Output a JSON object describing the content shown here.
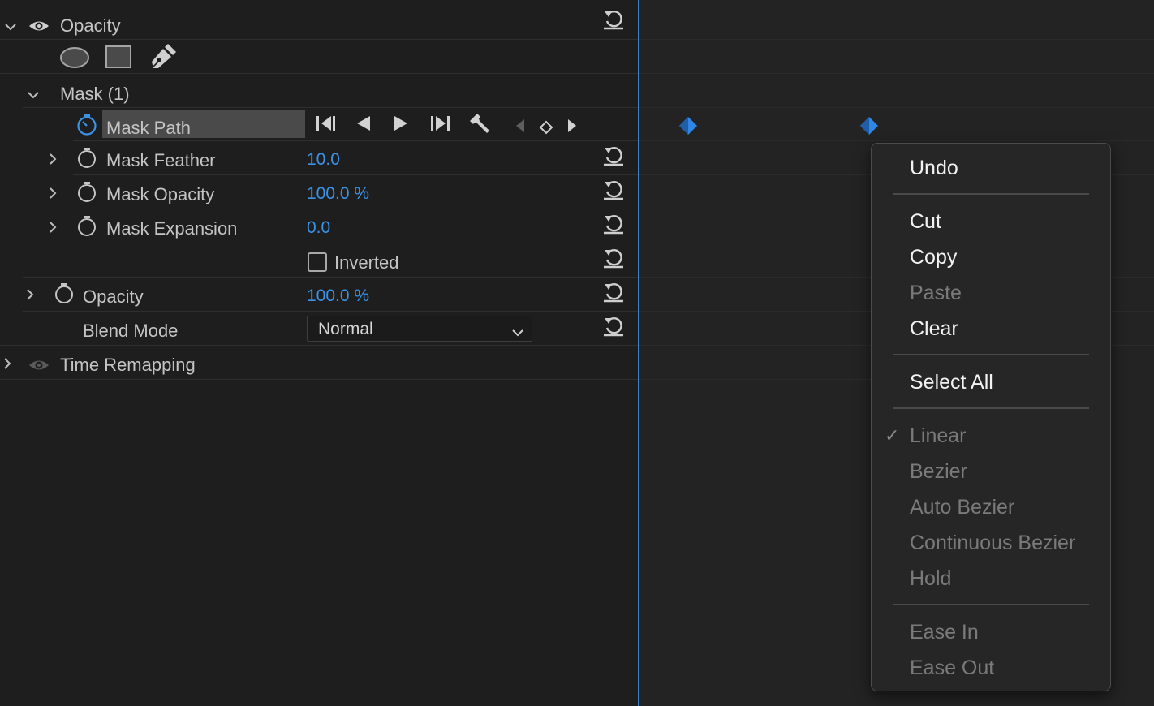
{
  "effects_panel": {
    "opacity_group": {
      "label": "Opacity"
    },
    "mask": {
      "label": "Mask (1)"
    },
    "mask_path": {
      "label": "Mask Path"
    },
    "mask_feather": {
      "label": "Mask Feather",
      "value": "10.0"
    },
    "mask_opacity": {
      "label": "Mask Opacity",
      "value": "100.0 %"
    },
    "mask_expansion": {
      "label": "Mask Expansion",
      "value": "0.0"
    },
    "inverted": {
      "label": "Inverted",
      "checked": false
    },
    "opacity": {
      "label": "Opacity",
      "value": "100.0 %"
    },
    "blend_mode": {
      "label": "Blend Mode",
      "selected": "Normal"
    },
    "time_remapping": {
      "label": "Time Remapping"
    }
  },
  "timeline": {
    "keyframe_color": "#2f86e6",
    "playhead_color": "#3b82c4"
  },
  "context_menu": {
    "undo": "Undo",
    "cut": "Cut",
    "copy": "Copy",
    "paste": "Paste",
    "clear": "Clear",
    "select_all": "Select All",
    "check_mark": "✓",
    "linear": "Linear",
    "bezier": "Bezier",
    "auto_bezier": "Auto Bezier",
    "continuous_bezier": "Continuous Bezier",
    "hold": "Hold",
    "ease_in": "Ease In",
    "ease_out": "Ease Out"
  }
}
